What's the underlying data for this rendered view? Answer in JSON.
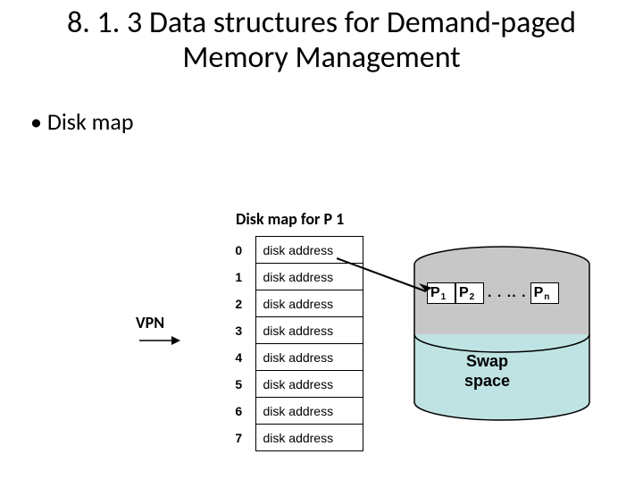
{
  "title": "8. 1. 3 Data structures for Demand-paged Memory Management",
  "bullet1": "Disk map",
  "caption": "Disk map for P 1",
  "vpn_label": "VPN",
  "table": {
    "rows": [
      {
        "idx": "0",
        "val": "disk address"
      },
      {
        "idx": "1",
        "val": "disk address"
      },
      {
        "idx": "2",
        "val": "disk address"
      },
      {
        "idx": "3",
        "val": "disk address"
      },
      {
        "idx": "4",
        "val": "disk address"
      },
      {
        "idx": "5",
        "val": "disk address"
      },
      {
        "idx": "6",
        "val": "disk address"
      },
      {
        "idx": "7",
        "val": "disk address"
      }
    ]
  },
  "processes": {
    "p1": {
      "name": "P",
      "sub": "1"
    },
    "p2": {
      "name": "P",
      "sub": "2"
    },
    "dots": ". . .. .",
    "pn": {
      "name": "P",
      "sub": "n"
    }
  },
  "swap_label_l1": "Swap",
  "swap_label_l2": "space"
}
